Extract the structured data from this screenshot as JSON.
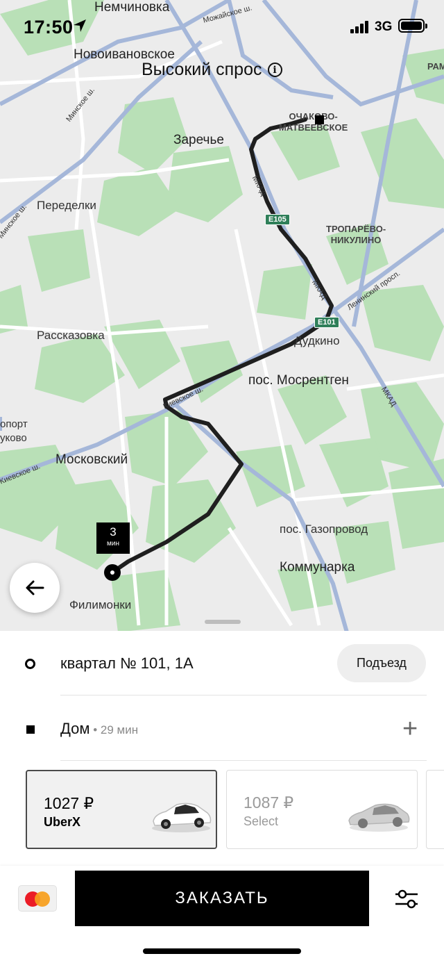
{
  "status_bar": {
    "time": "17:50",
    "network": "3G",
    "location_icon": "location-arrow-icon",
    "signal_icon": "signal-bars-icon",
    "battery_icon": "battery-icon"
  },
  "map": {
    "demand_label": "Высокий спрос",
    "info_icon": "info-icon",
    "places": {
      "nemchinovka": "Немчиновка",
      "novoivanovskoe": "Новоивановское",
      "zarechye": "Заречье",
      "peredelki": "Переделки",
      "ochakovo": "ОЧАКОВО-",
      "matveevskoe": "МАТВЕЕВСКОЕ",
      "troparevo": "ТРОПАРЁВО-",
      "nikulino": "НИКУЛИНО",
      "rasskazovka": "Рассказовка",
      "dudkino": "Дудкино",
      "mosrentgen": "пос. Мосрентген",
      "moskovsky": "Московский",
      "gazoprovod": "пос. Газопровод",
      "kommunarka": "Коммунарка",
      "filimonki": "Филимонки",
      "airport1": "опорт",
      "airport2": "уково",
      "ram": "РАМ"
    },
    "roads": {
      "mozhayskoe": "Можайское ш.",
      "minskoe1": "Минское ш.",
      "minskoe2": "Минское ш.",
      "mkad1": "МКАД",
      "mkad2": "МКАД",
      "mkad3": "МКАД",
      "leninsky": "Ленинский просп.",
      "kievskoe1": "Киевское ш.",
      "kievskoe2": "Киевское ш.",
      "e105": "E105",
      "e101": "E101"
    },
    "eta_badge": {
      "value": "3",
      "unit": "мин"
    },
    "back_icon": "arrow-left-icon"
  },
  "trip": {
    "pickup_address": "квартал № 101, 1А",
    "entrance_button": "Подъезд",
    "destination_name": "Дом",
    "destination_eta": " • 29 мин",
    "add_stop_icon": "plus-icon",
    "add_stop_symbol": "+"
  },
  "products": [
    {
      "price": "1027 ₽",
      "name": "UberX",
      "selected": true
    },
    {
      "price": "1087 ₽",
      "name": "Select",
      "selected": false
    }
  ],
  "footer": {
    "payment_icon": "mastercard-icon",
    "order_button": "ЗАКАЗАТЬ",
    "options_icon": "sliders-icon"
  },
  "colors": {
    "map_bg": "#ececec",
    "park_green": "#b7dfb6",
    "road_blue": "#9fb3d6",
    "route": "#1a1a1a",
    "mkad_shield": "#2f7f59"
  }
}
